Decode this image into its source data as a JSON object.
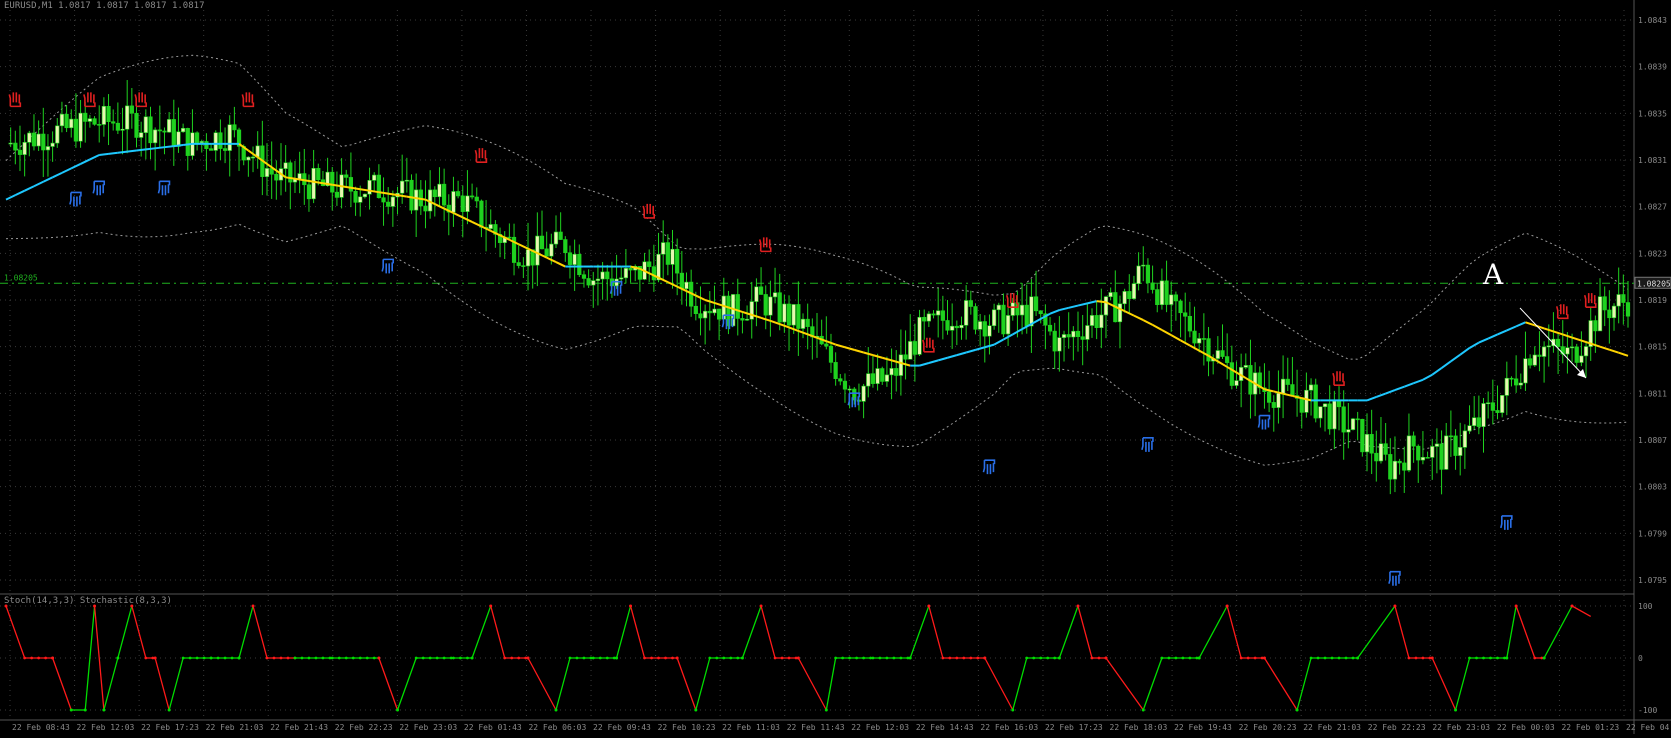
{
  "chart_header": "EURUSD,M1  1.0817 1.0817 1.0817 1.0817",
  "indicator_header": "Stoch(14,3,3) Stochastic(8,3,3)",
  "price_label_left": "1.08205",
  "annotation_label": "A",
  "colors": {
    "background": "#000000",
    "grid": "#3a3a3a",
    "bull": "#e8f7b0",
    "bear": "#1fd21f",
    "ma_up": "#1ec8ff",
    "ma_down": "#ffd400",
    "band": "#9a9a9a",
    "hline": "#1fb11f",
    "osc_up": "#00dd00",
    "osc_down": "#ff1a1a",
    "signal_buy": "#2a6fe8",
    "signal_sell": "#e02020",
    "axis_text": "#8a8a8a",
    "arrow": "#ffffff"
  },
  "chart_data": [
    {
      "type": "candlestick",
      "title": "",
      "price_ticks": [
        "1.0843",
        "1.0839",
        "1.0835",
        "1.0831",
        "1.0827",
        "1.0823",
        "1.0819",
        "1.0815",
        "1.0811",
        "1.0807",
        "1.0803",
        "1.0799",
        "1.0795"
      ],
      "time_ticks": [
        "22 Feb 08:43",
        "22 Feb 12:03",
        "22 Feb 17:23",
        "22 Feb 21:03",
        "22 Feb 21:43",
        "22 Feb 22:23",
        "22 Feb 23:03",
        "22 Feb 01:43",
        "22 Feb 06:03",
        "22 Feb 09:43",
        "22 Feb 10:23",
        "22 Feb 11:03",
        "22 Feb 11:43",
        "22 Feb 12:03",
        "22 Feb 14:43",
        "22 Feb 16:03",
        "22 Feb 17:23",
        "22 Feb 18:03",
        "22 Feb 19:43",
        "22 Feb 20:23",
        "22 Feb 21:03",
        "22 Feb 22:23",
        "22 Feb 23:03",
        "22 Feb 00:03",
        "22 Feb 01:23",
        "22 Feb 04:43"
      ],
      "current_price": 1.08205,
      "ylim": [
        1.0793,
        1.0845
      ],
      "close_path": [
        [
          0,
          1.0833
        ],
        [
          10,
          1.0834
        ],
        [
          20,
          1.0835
        ],
        [
          28,
          1.0835
        ],
        [
          35,
          1.0834
        ],
        [
          40,
          1.0833
        ],
        [
          48,
          1.0834
        ],
        [
          58,
          1.083
        ],
        [
          70,
          1.0829
        ],
        [
          80,
          1.0829
        ],
        [
          90,
          1.0828
        ],
        [
          98,
          1.0828
        ],
        [
          105,
          1.0825
        ],
        [
          112,
          1.0823
        ],
        [
          120,
          1.0824
        ],
        [
          126,
          1.0821
        ],
        [
          134,
          1.0821
        ],
        [
          142,
          1.0823
        ],
        [
          148,
          1.0819
        ],
        [
          156,
          1.0818
        ],
        [
          162,
          1.0819
        ],
        [
          170,
          1.0817
        ],
        [
          178,
          1.0813
        ],
        [
          182,
          1.0811
        ],
        [
          190,
          1.0812
        ],
        [
          196,
          1.0816
        ],
        [
          204,
          1.0818
        ],
        [
          212,
          1.0817
        ],
        [
          220,
          1.0818
        ],
        [
          226,
          1.0815
        ],
        [
          232,
          1.0817
        ],
        [
          240,
          1.0819
        ],
        [
          244,
          1.0822
        ],
        [
          250,
          1.0818
        ],
        [
          256,
          1.0816
        ],
        [
          262,
          1.0813
        ],
        [
          270,
          1.0811
        ],
        [
          280,
          1.081
        ],
        [
          290,
          1.0807
        ],
        [
          297,
          1.0804
        ],
        [
          302,
          1.0806
        ],
        [
          308,
          1.0805
        ],
        [
          316,
          1.0808
        ],
        [
          322,
          1.0811
        ],
        [
          328,
          1.0815
        ],
        [
          336,
          1.0814
        ],
        [
          342,
          1.0818
        ],
        [
          348,
          1.0819
        ]
      ],
      "ma_path": [
        [
          0,
          1.0828
        ],
        [
          20,
          1.0832
        ],
        [
          40,
          1.0833
        ],
        [
          50,
          1.0833
        ],
        [
          60,
          1.083
        ],
        [
          75,
          1.0829
        ],
        [
          90,
          1.0828
        ],
        [
          105,
          1.0825
        ],
        [
          120,
          1.0822
        ],
        [
          135,
          1.0822
        ],
        [
          150,
          1.0819
        ],
        [
          165,
          1.0817
        ],
        [
          178,
          1.0815
        ],
        [
          195,
          1.0813
        ],
        [
          212,
          1.0815
        ],
        [
          225,
          1.0818
        ],
        [
          235,
          1.0819
        ],
        [
          245,
          1.0817
        ],
        [
          258,
          1.0814
        ],
        [
          270,
          1.0811
        ],
        [
          280,
          1.081
        ],
        [
          292,
          1.081
        ],
        [
          305,
          1.0812
        ],
        [
          315,
          1.0815
        ],
        [
          326,
          1.0817
        ],
        [
          348,
          1.0814
        ]
      ],
      "signals": [
        {
          "type": "sell",
          "t": 2,
          "price": 1.0836
        },
        {
          "type": "sell",
          "t": 18,
          "price": 1.0836
        },
        {
          "type": "sell",
          "t": 29,
          "price": 1.0836
        },
        {
          "type": "sell",
          "t": 52,
          "price": 1.0836
        },
        {
          "type": "buy",
          "t": 15,
          "price": 1.0829
        },
        {
          "type": "buy",
          "t": 20,
          "price": 1.083
        },
        {
          "type": "buy",
          "t": 34,
          "price": 1.083
        },
        {
          "type": "buy",
          "t": 82,
          "price": 1.0823
        },
        {
          "type": "sell",
          "t": 102,
          "price": 1.0831
        },
        {
          "type": "sell",
          "t": 138,
          "price": 1.0826
        },
        {
          "type": "buy",
          "t": 131,
          "price": 1.0821
        },
        {
          "type": "sell",
          "t": 163,
          "price": 1.0823
        },
        {
          "type": "buy",
          "t": 155,
          "price": 1.0818
        },
        {
          "type": "buy",
          "t": 182,
          "price": 1.0811
        },
        {
          "type": "sell",
          "t": 198,
          "price": 1.0814
        },
        {
          "type": "sell",
          "t": 216,
          "price": 1.0818
        },
        {
          "type": "buy",
          "t": 211,
          "price": 1.0805
        },
        {
          "type": "buy",
          "t": 245,
          "price": 1.0807
        },
        {
          "type": "buy",
          "t": 270,
          "price": 1.0809
        },
        {
          "type": "sell",
          "t": 286,
          "price": 1.0811
        },
        {
          "type": "sell",
          "t": 334,
          "price": 1.0817
        },
        {
          "type": "buy",
          "t": 298,
          "price": 1.0795
        },
        {
          "type": "buy",
          "t": 322,
          "price": 1.08
        },
        {
          "type": "sell",
          "t": 340,
          "price": 1.0818
        }
      ]
    },
    {
      "type": "line",
      "title": "",
      "ylim": [
        -100,
        100
      ],
      "levels": [
        100,
        0,
        -100
      ],
      "level_labels": [
        "100",
        "0",
        "-100"
      ],
      "series": [
        {
          "values": [
            [
              0,
              100
            ],
            [
              4,
              0
            ],
            [
              10,
              0
            ],
            [
              14,
              -100
            ],
            [
              17,
              -100
            ],
            [
              19,
              100
            ],
            [
              21,
              -100
            ],
            [
              24,
              0
            ],
            [
              27,
              100
            ],
            [
              30,
              0
            ],
            [
              32,
              0
            ],
            [
              35,
              -100
            ],
            [
              38,
              0
            ],
            [
              44,
              0
            ],
            [
              50,
              0
            ],
            [
              53,
              100
            ],
            [
              56,
              0
            ],
            [
              62,
              0
            ],
            [
              70,
              0
            ],
            [
              80,
              0
            ],
            [
              84,
              -100
            ],
            [
              88,
              0
            ],
            [
              96,
              0
            ],
            [
              100,
              0
            ],
            [
              104,
              100
            ],
            [
              107,
              0
            ],
            [
              112,
              0
            ],
            [
              118,
              -100
            ],
            [
              121,
              0
            ],
            [
              126,
              0
            ],
            [
              131,
              0
            ],
            [
              134,
              100
            ],
            [
              137,
              0
            ],
            [
              144,
              0
            ],
            [
              148,
              -100
            ],
            [
              151,
              0
            ],
            [
              158,
              0
            ],
            [
              162,
              100
            ],
            [
              165,
              0
            ],
            [
              170,
              0
            ],
            [
              176,
              -100
            ],
            [
              178,
              0
            ],
            [
              186,
              0
            ],
            [
              194,
              0
            ],
            [
              198,
              100
            ],
            [
              201,
              0
            ],
            [
              210,
              0
            ],
            [
              216,
              -100
            ],
            [
              219,
              0
            ],
            [
              226,
              0
            ],
            [
              230,
              100
            ],
            [
              233,
              0
            ],
            [
              236,
              0
            ],
            [
              244,
              -100
            ],
            [
              248,
              0
            ],
            [
              256,
              0
            ],
            [
              262,
              100
            ],
            [
              265,
              0
            ],
            [
              270,
              0
            ],
            [
              277,
              -100
            ],
            [
              280,
              0
            ],
            [
              290,
              0
            ],
            [
              298,
              100
            ],
            [
              301,
              0
            ],
            [
              306,
              0
            ],
            [
              311,
              -100
            ],
            [
              314,
              0
            ],
            [
              322,
              0
            ],
            [
              324,
              100
            ],
            [
              328,
              0
            ],
            [
              330,
              0
            ],
            [
              336,
              100
            ],
            [
              340,
              80
            ]
          ]
        }
      ]
    }
  ]
}
